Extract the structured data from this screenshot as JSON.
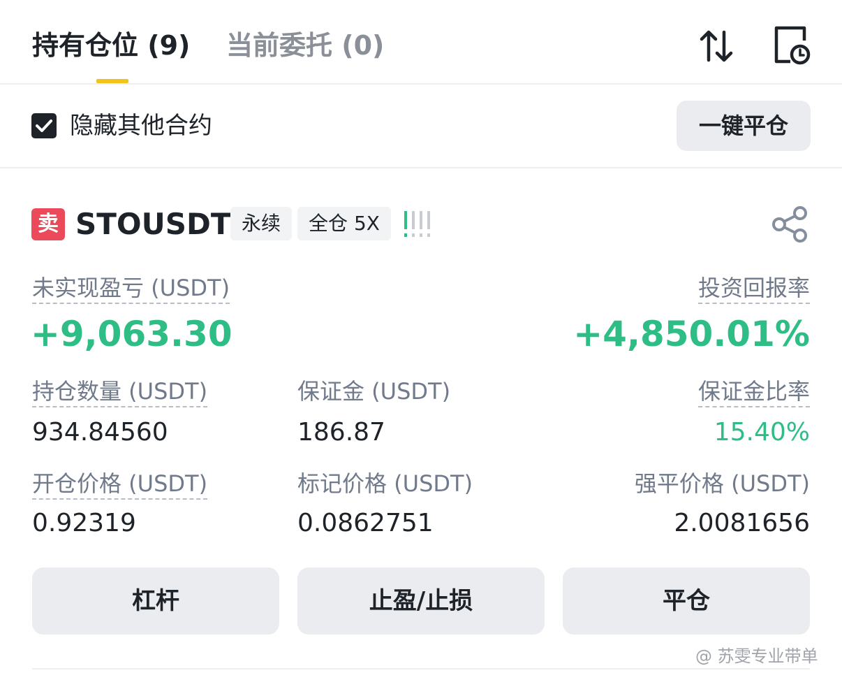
{
  "tabs": {
    "positions": "持有仓位 (9)",
    "open_orders": "当前委托 (0)"
  },
  "toolbar": {
    "hide_other_contracts": "隐藏其他合约",
    "hide_other_checked": true,
    "close_all": "一键平仓"
  },
  "position": {
    "side_badge": "卖",
    "symbol": "STOUSDT",
    "tag_type": "永续",
    "tag_margin": "全仓 5X",
    "unrealized_pnl_label": "未实现盈亏 (USDT)",
    "unrealized_pnl_value": "+9,063.30",
    "roe_label": "投资回报率",
    "roe_value": "+4,850.01%",
    "size_label": "持仓数量 (USDT)",
    "size_value": "934.84560",
    "margin_label": "保证金 (USDT)",
    "margin_value": "186.87",
    "margin_ratio_label": "保证金比率",
    "margin_ratio_value": "15.40%",
    "entry_price_label": "开仓价格 (USDT)",
    "entry_price_value": "0.92319",
    "mark_price_label": "标记价格 (USDT)",
    "mark_price_value": "0.0862751",
    "liq_price_label": "强平价格 (USDT)",
    "liq_price_value": "2.0081656"
  },
  "actions": {
    "leverage": "杠杆",
    "tp_sl": "止盈/止损",
    "close": "平仓"
  },
  "watermark": "@ 苏雯专业带单",
  "colors": {
    "accent": "#f0c419",
    "profit": "#2ebd85",
    "sell": "#ea4a5a"
  }
}
